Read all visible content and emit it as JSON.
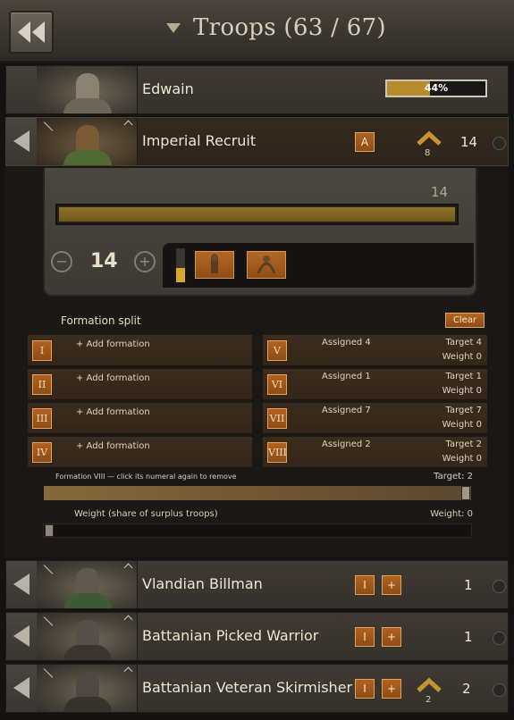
{
  "header": {
    "title": "Troops (63 / 67)"
  },
  "hero": {
    "name": "Edwain",
    "progress_label": "44%",
    "progress": 0.44
  },
  "selected_troop": {
    "name": "Imperial Recruit",
    "formation_label": "A",
    "upgrade_count": "8",
    "count": "14",
    "slider_max_label": "14",
    "slider_value": 1.0,
    "transfer_count": "14",
    "minus_label": "−",
    "plus_label": "+"
  },
  "formation_split": {
    "title": "Formation split",
    "clear_label": "Clear",
    "left": [
      {
        "numeral": "I",
        "text": "+ Add formation"
      },
      {
        "numeral": "II",
        "text": "+ Add formation"
      },
      {
        "numeral": "III",
        "text": "+ Add formation"
      },
      {
        "numeral": "IV",
        "text": "+ Add formation"
      }
    ],
    "right": [
      {
        "numeral": "V",
        "assigned": "Assigned 4",
        "target": "Target 4",
        "weight": "Weight 0"
      },
      {
        "numeral": "VI",
        "assigned": "Assigned 1",
        "target": "Target 1",
        "weight": "Weight 0"
      },
      {
        "numeral": "VII",
        "assigned": "Assigned 7",
        "target": "Target 7",
        "weight": "Weight 0"
      },
      {
        "numeral": "VIII",
        "assigned": "Assigned 2",
        "target": "Target 2",
        "weight": "Weight 0"
      }
    ],
    "hint": "Formation VIII — click its numeral again to remove",
    "target_label": "Target: 2",
    "target_value": 1.0,
    "weight_title": "Weight (share of surplus troops)",
    "weight_label": "Weight: 0",
    "weight_value": 0.0
  },
  "troops": [
    {
      "name": "Vlandian Billman",
      "formation_label": "I",
      "add_label": "+",
      "count": "1"
    },
    {
      "name": "Battanian Picked Warrior",
      "formation_label": "I",
      "add_label": "+",
      "count": "1"
    },
    {
      "name": "Battanian Veteran Skirmisher",
      "formation_label": "I",
      "add_label": "+",
      "count": "2",
      "upgrade_count": "2"
    }
  ],
  "colors": {
    "accent_orange": "#a55a1c",
    "bar_gold": "#8f7228",
    "panel_brown": "#3b2c1e"
  },
  "icons": {
    "back": "double-chevron-left-icon",
    "collapse": "triangle-left-icon",
    "upgrade": "chevron-up-icon",
    "lock": "radio-dot-icon"
  }
}
